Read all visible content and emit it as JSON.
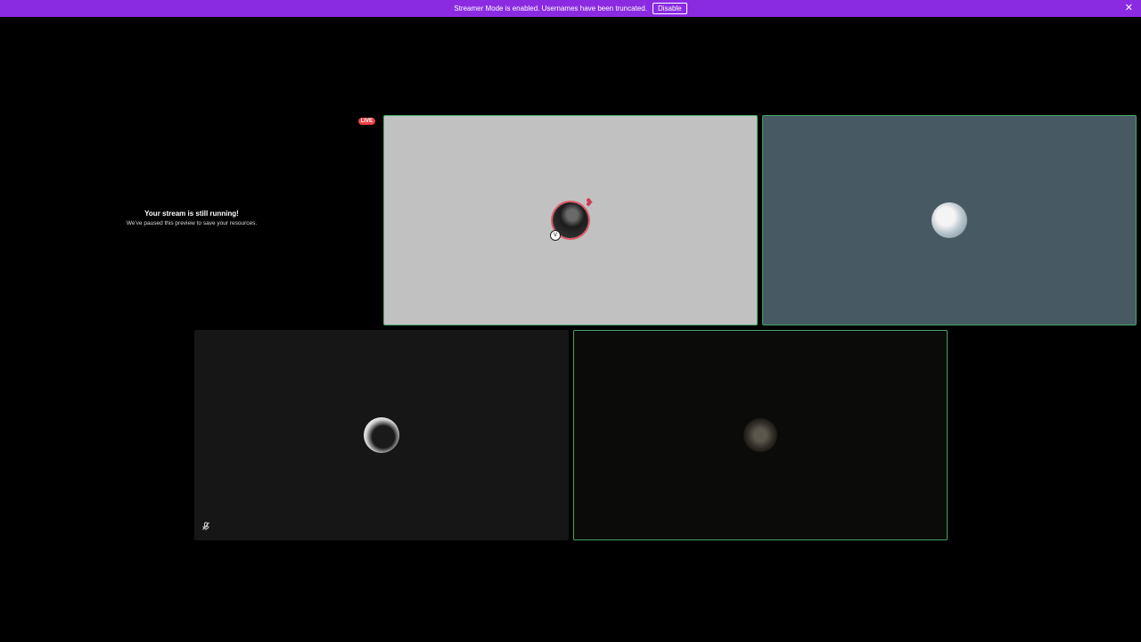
{
  "notice": {
    "text": "Streamer Mode is enabled. Usernames have been truncated.",
    "disable_label": "Disable",
    "close_icon": "close-icon",
    "color": "#8a2be2"
  },
  "paused_preview": {
    "title": "Your stream is still running!",
    "subtitle": "We've paused this preview to save your resources.",
    "live_label": "LIVE",
    "live_color": "#ed4245"
  },
  "tiles": [
    {
      "id": "tile-1",
      "background": "#c1c1c1",
      "speaking": true,
      "avatar_icon": "avatar-icon"
    },
    {
      "id": "tile-2",
      "background": "#475a63",
      "speaking": true,
      "avatar_icon": "avatar-icon"
    },
    {
      "id": "tile-3",
      "background": "#161616",
      "speaking": false,
      "muted": true,
      "avatar_icon": "avatar-icon",
      "status_icon": "mic-muted-icon"
    },
    {
      "id": "tile-4",
      "background": "#0b0b09",
      "speaking": true,
      "avatar_icon": "avatar-icon"
    }
  ],
  "colors": {
    "speaking_border": "#43a55d",
    "background": "#000000"
  }
}
